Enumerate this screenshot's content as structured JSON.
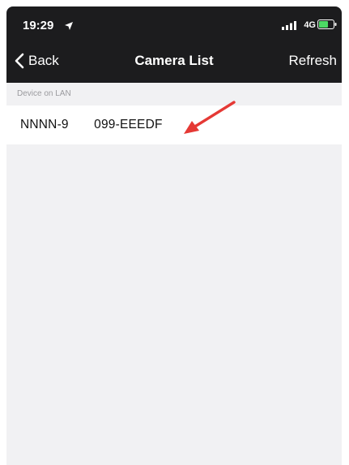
{
  "status_bar": {
    "time": "19:29",
    "network": "4G",
    "icons": [
      "location-arrow-icon",
      "signal-bars-icon",
      "battery-icon"
    ]
  },
  "nav_bar": {
    "back_label": "Back",
    "title": "Camera List",
    "refresh_label": "Refresh"
  },
  "device_list": {
    "section_header": "Device on LAN",
    "devices": [
      {
        "name": "NNNN-9  099-EEEDF"
      }
    ]
  },
  "colors": {
    "nav_background": "#1c1c1e",
    "page_background": "#f1f1f3",
    "row_background": "#ffffff",
    "annotation_arrow": "#e53935"
  }
}
